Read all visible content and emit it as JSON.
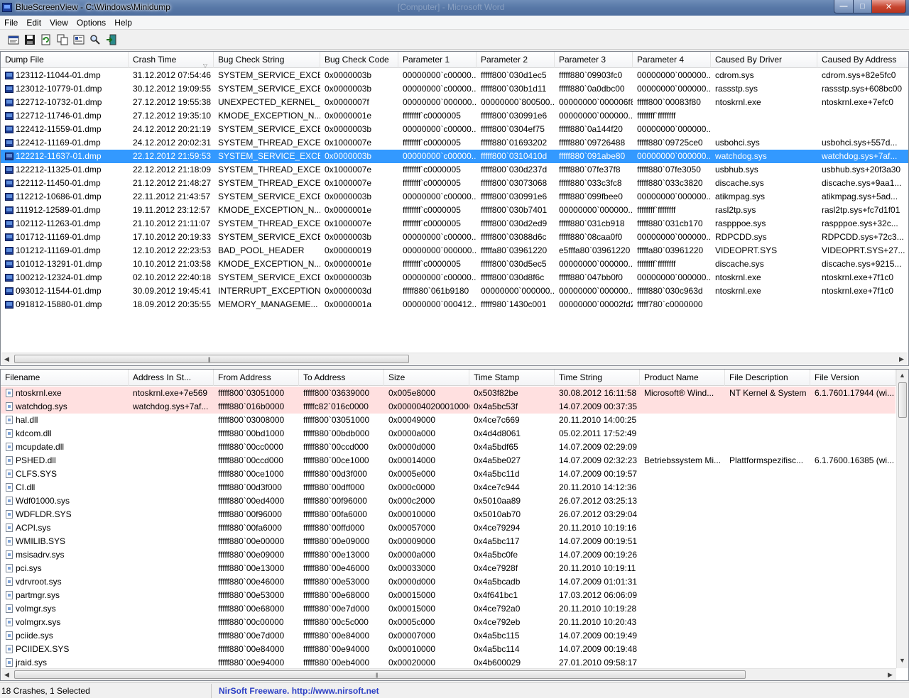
{
  "window": {
    "title": "BlueScreenView  -  C:\\Windows\\Minidump",
    "ghost_title": "[Computer] - Microsoft Word"
  },
  "menu": [
    "File",
    "Edit",
    "View",
    "Options",
    "Help"
  ],
  "toolbar_icons": [
    "open-folder-icon",
    "save-icon",
    "refresh-icon",
    "copy-icon",
    "properties-icon",
    "find-icon",
    "exit-icon"
  ],
  "crash_list": {
    "columns": [
      "Dump File",
      "Crash Time",
      "Bug Check String",
      "Bug Check Code",
      "Parameter 1",
      "Parameter 2",
      "Parameter 3",
      "Parameter 4",
      "Caused By Driver",
      "Caused By Address"
    ],
    "sorted_column": "Crash Time",
    "selected_index": 6,
    "rows": [
      [
        "123112-11044-01.dmp",
        "31.12.2012 07:54:46",
        "SYSTEM_SERVICE_EXCE...",
        "0x0000003b",
        "00000000`c00000...",
        "fffff800`030d1ec5",
        "fffff880`09903fc0",
        "00000000`000000...",
        "cdrom.sys",
        "cdrom.sys+82e5fc0"
      ],
      [
        "123012-10779-01.dmp",
        "30.12.2012 19:09:55",
        "SYSTEM_SERVICE_EXCE...",
        "0x0000003b",
        "00000000`c00000...",
        "fffff800`030b1d11",
        "fffff880`0a0dbc00",
        "00000000`000000...",
        "rassstp.sys",
        "rassstp.sys+608bc00"
      ],
      [
        "122712-10732-01.dmp",
        "27.12.2012 19:55:38",
        "UNEXPECTED_KERNEL_...",
        "0x0000007f",
        "00000000`000000...",
        "00000000`800500...",
        "00000000`000006f8",
        "fffff800`00083f80",
        "ntoskrnl.exe",
        "ntoskrnl.exe+7efc0"
      ],
      [
        "122712-11746-01.dmp",
        "27.12.2012 19:35:10",
        "KMODE_EXCEPTION_N...",
        "0x0000001e",
        "ffffffff`c0000005",
        "fffff800`030991e6",
        "00000000`000000...",
        "ffffffff`ffffffff",
        "",
        ""
      ],
      [
        "122412-11559-01.dmp",
        "24.12.2012 20:21:19",
        "SYSTEM_SERVICE_EXCE...",
        "0x0000003b",
        "00000000`c00000...",
        "fffff800`0304ef75",
        "fffff880`0a144f20",
        "00000000`000000...",
        "",
        ""
      ],
      [
        "122412-11169-01.dmp",
        "24.12.2012 20:02:31",
        "SYSTEM_THREAD_EXCE...",
        "0x1000007e",
        "ffffffff`c0000005",
        "fffff880`01693202",
        "fffff880`09726488",
        "fffff880`09725ce0",
        "usbohci.sys",
        "usbohci.sys+557d..."
      ],
      [
        "122212-11637-01.dmp",
        "22.12.2012 21:59:53",
        "SYSTEM_SERVICE_EXCE...",
        "0x0000003b",
        "00000000`c00000...",
        "fffff800`0310410d",
        "fffff880`091abe80",
        "00000000`000000...",
        "watchdog.sys",
        "watchdog.sys+7af..."
      ],
      [
        "122212-11325-01.dmp",
        "22.12.2012 21:18:09",
        "SYSTEM_THREAD_EXCE...",
        "0x1000007e",
        "ffffffff`c0000005",
        "fffff800`030d237d",
        "fffff880`07fe37f8",
        "fffff880`07fe3050",
        "usbhub.sys",
        "usbhub.sys+20f3a30"
      ],
      [
        "122112-11450-01.dmp",
        "21.12.2012 21:48:27",
        "SYSTEM_THREAD_EXCE...",
        "0x1000007e",
        "ffffffff`c0000005",
        "fffff800`03073068",
        "fffff880`033c3fc8",
        "fffff880`033c3820",
        "discache.sys",
        "discache.sys+9aa1..."
      ],
      [
        "112212-10686-01.dmp",
        "22.11.2012 21:43:57",
        "SYSTEM_SERVICE_EXCE...",
        "0x0000003b",
        "00000000`c00000...",
        "fffff800`030991e6",
        "fffff880`099fbee0",
        "00000000`000000...",
        "atikmpag.sys",
        "atikmpag.sys+5ad..."
      ],
      [
        "111912-12589-01.dmp",
        "19.11.2012 23:12:57",
        "KMODE_EXCEPTION_N...",
        "0x0000001e",
        "ffffffff`c0000005",
        "fffff800`030b7401",
        "00000000`000000...",
        "ffffffff`ffffffff",
        "rasl2tp.sys",
        "rasl2tp.sys+fc7d1f01"
      ],
      [
        "102112-11263-01.dmp",
        "21.10.2012 21:11:07",
        "SYSTEM_THREAD_EXCE...",
        "0x1000007e",
        "ffffffff`c0000005",
        "fffff800`030d2ed9",
        "fffff880`031cb918",
        "fffff880`031cb170",
        "raspppoe.sys",
        "raspppoe.sys+32c..."
      ],
      [
        "101712-11169-01.dmp",
        "17.10.2012 20:19:33",
        "SYSTEM_SERVICE_EXCE...",
        "0x0000003b",
        "00000000`c00000...",
        "fffff800`03088d6c",
        "fffff880`08caa0f0",
        "00000000`000000...",
        "RDPCDD.sys",
        "RDPCDD.sys+72c3..."
      ],
      [
        "101212-11169-01.dmp",
        "12.10.2012 22:23:53",
        "BAD_POOL_HEADER",
        "0x00000019",
        "00000000`000000...",
        "fffffa80`03961220",
        "e5fffa80`03961220",
        "fffffa80`03961220",
        "VIDEOPRT.SYS",
        "VIDEOPRT.SYS+27..."
      ],
      [
        "101012-13291-01.dmp",
        "10.10.2012 21:03:58",
        "KMODE_EXCEPTION_N...",
        "0x0000001e",
        "ffffffff`c0000005",
        "fffff800`030d5ec5",
        "00000000`000000...",
        "ffffffff`ffffffff",
        "discache.sys",
        "discache.sys+9215..."
      ],
      [
        "100212-12324-01.dmp",
        "02.10.2012 22:40:18",
        "SYSTEM_SERVICE_EXCE...",
        "0x0000003b",
        "00000000`c00000...",
        "fffff800`030d8f6c",
        "fffff880`047bb0f0",
        "00000000`000000...",
        "ntoskrnl.exe",
        "ntoskrnl.exe+7f1c0"
      ],
      [
        "093012-11544-01.dmp",
        "30.09.2012 19:45:41",
        "INTERRUPT_EXCEPTION...",
        "0x0000003d",
        "fffff880`061b9180",
        "00000000`000000...",
        "00000000`000000...",
        "fffff880`030c963d",
        "ntoskrnl.exe",
        "ntoskrnl.exe+7f1c0"
      ],
      [
        "091812-15880-01.dmp",
        "18.09.2012 20:35:55",
        "MEMORY_MANAGEME...",
        "0x0000001a",
        "00000000`000412...",
        "fffff980`1430c001",
        "00000000`00002fd2",
        "fffff780`c0000000",
        "",
        ""
      ]
    ]
  },
  "driver_list": {
    "columns": [
      "Filename",
      "Address In St...",
      "From Address",
      "To Address",
      "Size",
      "Time Stamp",
      "Time String",
      "Product Name",
      "File Description",
      "File Version"
    ],
    "highlighted_count": 2,
    "rows": [
      [
        "ntoskrnl.exe",
        "ntoskrnl.exe+7e569",
        "fffff800`03051000",
        "fffff800`03639000",
        "0x005e8000",
        "0x503f82be",
        "30.08.2012 16:11:58",
        "Microsoft® Wind...",
        "NT Kernel & System",
        "6.1.7601.17944 (wi..."
      ],
      [
        "watchdog.sys",
        "watchdog.sys+7af...",
        "fffff880`016b0000",
        "fffffc82`016c0000",
        "0x0000040200010000",
        "0x4a5bc53f",
        "14.07.2009 00:37:35",
        "",
        "",
        ""
      ],
      [
        "hal.dll",
        "",
        "fffff800`03008000",
        "fffff800`03051000",
        "0x00049000",
        "0x4ce7c669",
        "20.11.2010 14:00:25",
        "",
        "",
        ""
      ],
      [
        "kdcom.dll",
        "",
        "fffff880`00bd1000",
        "fffff880`00bdb000",
        "0x0000a000",
        "0x4d4d8061",
        "05.02.2011 17:52:49",
        "",
        "",
        ""
      ],
      [
        "mcupdate.dll",
        "",
        "fffff880`00cc0000",
        "fffff880`00ccd000",
        "0x0000d000",
        "0x4a5bdf65",
        "14.07.2009 02:29:09",
        "",
        "",
        ""
      ],
      [
        "PSHED.dll",
        "",
        "fffff880`00ccd000",
        "fffff880`00ce1000",
        "0x00014000",
        "0x4a5be027",
        "14.07.2009 02:32:23",
        "Betriebssystem Mi...",
        "Plattformspezifisc...",
        "6.1.7600.16385 (wi..."
      ],
      [
        "CLFS.SYS",
        "",
        "fffff880`00ce1000",
        "fffff880`00d3f000",
        "0x0005e000",
        "0x4a5bc11d",
        "14.07.2009 00:19:57",
        "",
        "",
        ""
      ],
      [
        "CI.dll",
        "",
        "fffff880`00d3f000",
        "fffff880`00dff000",
        "0x000c0000",
        "0x4ce7c944",
        "20.11.2010 14:12:36",
        "",
        "",
        ""
      ],
      [
        "Wdf01000.sys",
        "",
        "fffff880`00ed4000",
        "fffff880`00f96000",
        "0x000c2000",
        "0x5010aa89",
        "26.07.2012 03:25:13",
        "",
        "",
        ""
      ],
      [
        "WDFLDR.SYS",
        "",
        "fffff880`00f96000",
        "fffff880`00fa6000",
        "0x00010000",
        "0x5010ab70",
        "26.07.2012 03:29:04",
        "",
        "",
        ""
      ],
      [
        "ACPI.sys",
        "",
        "fffff880`00fa6000",
        "fffff880`00ffd000",
        "0x00057000",
        "0x4ce79294",
        "20.11.2010 10:19:16",
        "",
        "",
        ""
      ],
      [
        "WMILIB.SYS",
        "",
        "fffff880`00e00000",
        "fffff880`00e09000",
        "0x00009000",
        "0x4a5bc117",
        "14.07.2009 00:19:51",
        "",
        "",
        ""
      ],
      [
        "msisadrv.sys",
        "",
        "fffff880`00e09000",
        "fffff880`00e13000",
        "0x0000a000",
        "0x4a5bc0fe",
        "14.07.2009 00:19:26",
        "",
        "",
        ""
      ],
      [
        "pci.sys",
        "",
        "fffff880`00e13000",
        "fffff880`00e46000",
        "0x00033000",
        "0x4ce7928f",
        "20.11.2010 10:19:11",
        "",
        "",
        ""
      ],
      [
        "vdrvroot.sys",
        "",
        "fffff880`00e46000",
        "fffff880`00e53000",
        "0x0000d000",
        "0x4a5bcadb",
        "14.07.2009 01:01:31",
        "",
        "",
        ""
      ],
      [
        "partmgr.sys",
        "",
        "fffff880`00e53000",
        "fffff880`00e68000",
        "0x00015000",
        "0x4f641bc1",
        "17.03.2012 06:06:09",
        "",
        "",
        ""
      ],
      [
        "volmgr.sys",
        "",
        "fffff880`00e68000",
        "fffff880`00e7d000",
        "0x00015000",
        "0x4ce792a0",
        "20.11.2010 10:19:28",
        "",
        "",
        ""
      ],
      [
        "volmgrx.sys",
        "",
        "fffff880`00c00000",
        "fffff880`00c5c000",
        "0x0005c000",
        "0x4ce792eb",
        "20.11.2010 10:20:43",
        "",
        "",
        ""
      ],
      [
        "pciide.sys",
        "",
        "fffff880`00e7d000",
        "fffff880`00e84000",
        "0x00007000",
        "0x4a5bc115",
        "14.07.2009 00:19:49",
        "",
        "",
        ""
      ],
      [
        "PCIIDEX.SYS",
        "",
        "fffff880`00e84000",
        "fffff880`00e94000",
        "0x00010000",
        "0x4a5bc114",
        "14.07.2009 00:19:48",
        "",
        "",
        ""
      ],
      [
        "jraid.sys",
        "",
        "fffff880`00e94000",
        "fffff880`00eb4000",
        "0x00020000",
        "0x4b600029",
        "27.01.2010 09:58:17",
        "",
        "",
        ""
      ]
    ]
  },
  "status": {
    "count_text": "18 Crashes, 1 Selected",
    "link_text": "NirSoft Freeware.  http://www.nirsoft.net"
  },
  "colors": {
    "selection": "#3399ff",
    "highlight_row": "#ffe0e0",
    "link": "#2b3ec4"
  }
}
